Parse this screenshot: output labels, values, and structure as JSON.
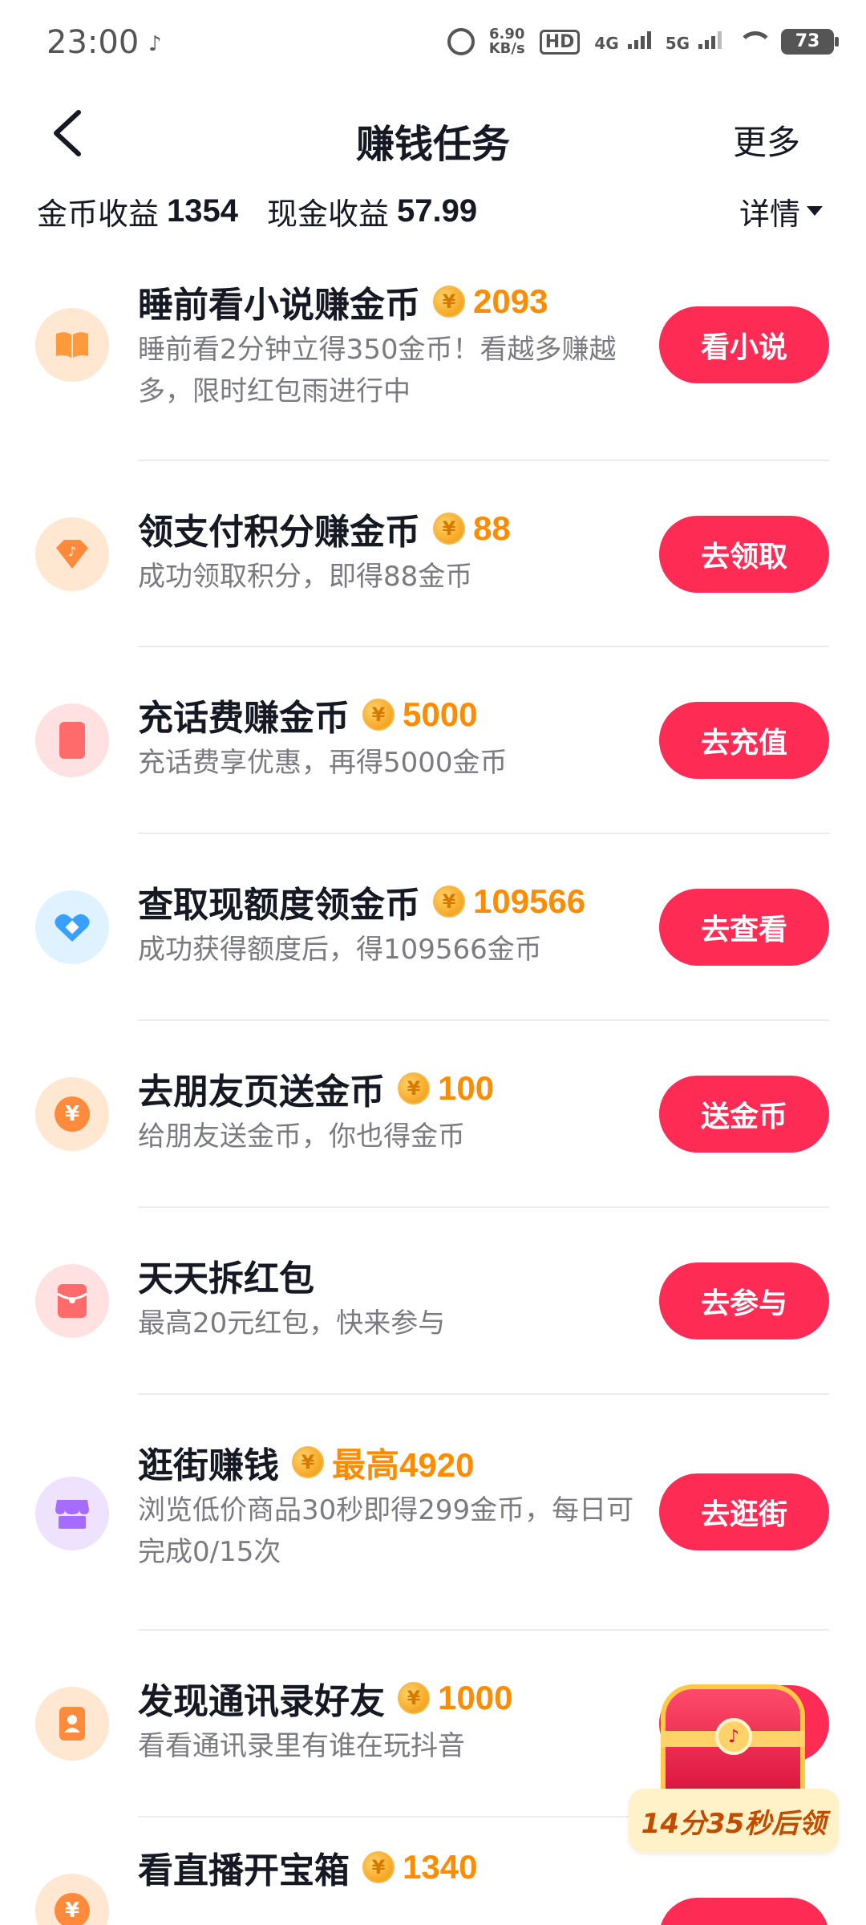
{
  "status_bar": {
    "time": "23:00",
    "net_speed_value": "6.90",
    "net_speed_unit": "KB/s",
    "hd_label": "HD",
    "signal_1": "4G",
    "signal_2": "5G",
    "battery": "73"
  },
  "nav": {
    "title": "赚钱任务",
    "more_label": "更多"
  },
  "summary": {
    "coin_label": "金币收益",
    "coin_value": "1354",
    "cash_label": "现金收益",
    "cash_value": "57.99",
    "detail_label": "详情"
  },
  "tasks": [
    {
      "title": "睡前看小说赚金币",
      "reward": "2093",
      "desc": "睡前看2分钟立得350金币！看越多赚越多，限时红包雨进行中",
      "button": "看小说",
      "icon": "book-icon",
      "icon_bg": "#ffe7d2",
      "icon_color": "#ff9a3c"
    },
    {
      "title": "领支付积分赚金币",
      "reward": "88",
      "desc": "成功领取积分，即得88金币",
      "button": "去领取",
      "icon": "diamond-icon",
      "icon_bg": "#ffe7d2",
      "icon_color": "#ff8a3c"
    },
    {
      "title": "充话费赚金币",
      "reward": "5000",
      "desc": "充话费享优惠，再得5000金币",
      "button": "去充值",
      "icon": "phone-icon",
      "icon_bg": "#ffe1e1",
      "icon_color": "#ff6b6b"
    },
    {
      "title": "查取现额度领金币",
      "reward": "109566",
      "desc": "成功获得额度后，得109566金币",
      "button": "去查看",
      "icon": "heart-app-icon",
      "icon_bg": "#dff2ff",
      "icon_color": "#3aa0ff"
    },
    {
      "title": "去朋友页送金币",
      "reward": "100",
      "desc": "给朋友送金币，你也得金币",
      "button": "送金币",
      "icon": "yen-coin-icon",
      "icon_bg": "#ffe7d2",
      "icon_color": "#ff8a3c"
    },
    {
      "title": "天天拆红包",
      "reward": "",
      "desc": "最高20元红包，快来参与",
      "button": "去参与",
      "icon": "red-envelope-icon",
      "icon_bg": "#ffe1e1",
      "icon_color": "#ff6b6b"
    },
    {
      "title": "逛街赚钱",
      "reward": "最高4920",
      "desc": "浏览低价商品30秒即得299金币，每日可完成0/15次",
      "button": "去逛街",
      "icon": "shop-icon",
      "icon_bg": "#efe2ff",
      "icon_color": "#a66bff"
    },
    {
      "title": "发现通讯录好友",
      "reward": "1000",
      "desc": "看看通讯录里有谁在玩抖音",
      "button": "",
      "icon": "contacts-icon",
      "icon_bg": "#ffe7d2",
      "icon_color": "#ff8a3c"
    },
    {
      "title": "看直播开宝箱",
      "reward": "1340",
      "desc": "",
      "button": "",
      "icon": "yen-coin-icon",
      "icon_bg": "#ffe7d2",
      "icon_color": "#ff8a3c"
    }
  ],
  "floating_chest": {
    "timer_label": "14分35秒后领"
  },
  "colors": {
    "accent": "#fe2c55",
    "reward": "#ff8c00"
  }
}
